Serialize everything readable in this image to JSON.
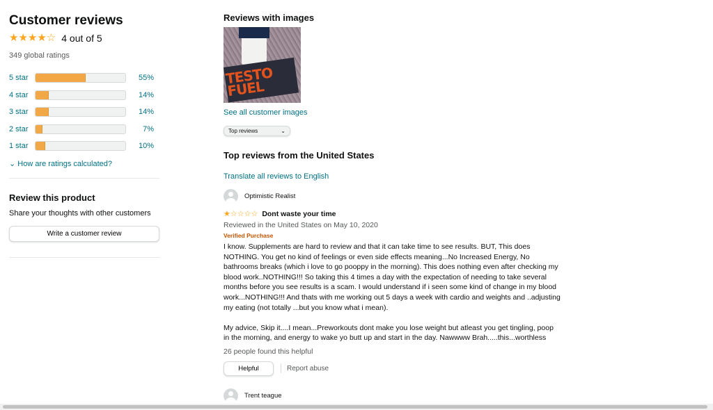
{
  "ratings": {
    "title": "Customer reviews",
    "stars_glyph": "★★★★☆",
    "average_text": "4 out of 5",
    "global_ratings": "349 global ratings",
    "histogram": [
      {
        "label": "5 star",
        "percent_text": "55%",
        "percent": 55
      },
      {
        "label": "4 star",
        "percent_text": "14%",
        "percent": 14
      },
      {
        "label": "3 star",
        "percent_text": "14%",
        "percent": 14
      },
      {
        "label": "2 star",
        "percent_text": "7%",
        "percent": 7
      },
      {
        "label": "1 star",
        "percent_text": "10%",
        "percent": 10
      }
    ],
    "how_calculated": "How are ratings calculated?"
  },
  "review_product": {
    "title": "Review this product",
    "subtitle": "Share your thoughts with other customers",
    "button_label": "Write a customer review"
  },
  "images": {
    "title": "Reviews with images",
    "thumbnail_text": "TESTO FUEL",
    "see_all": "See all customer images"
  },
  "sort": {
    "selected": "Top reviews"
  },
  "top_reviews": {
    "title": "Top reviews from the United States",
    "translate": "Translate all reviews to English"
  },
  "reviews": [
    {
      "author": "Optimistic Realist",
      "stars_glyph": "★☆☆☆☆",
      "rating": 1,
      "title": "Dont waste your time",
      "meta": "Reviewed in the United States on May 10, 2020",
      "verified": "Verified Purchase",
      "body_p1": "I know. Supplements are hard to review and that it can take time to see results. BUT, This does NOTHING. You get no kind of feelings or even side effects meaning...No Increased Energy, No bathrooms breaks (which i love to go pooppy in the morning). This does nothing even after checking my blood work..NOTHING!!! So taking this 4 times a day with the expectation of needing to take several months before you see results is a scam. I would understand if i seen some kind of change in my blood work...NOTHING!!! And thats with me working out 5 days a week with cardio and weights and ..adjusting my eating (not totally ...but you know what i mean).",
      "body_p2": "My advice, Skip it....I mean...Preworkouts dont make you lose weight but atleast you get tingling, poop in the morning, and energy to wake yo butt up and start in the day. Nawwww Brah.....this...worthless",
      "helpful_count": "26 people found this helpful",
      "helpful_label": "Helpful",
      "report_label": "Report abuse"
    },
    {
      "author": "Trent teague"
    }
  ],
  "colors": {
    "star": "#ffa41c",
    "bar_fill": "#f3a847",
    "link": "#007185",
    "verified": "#c45500"
  }
}
